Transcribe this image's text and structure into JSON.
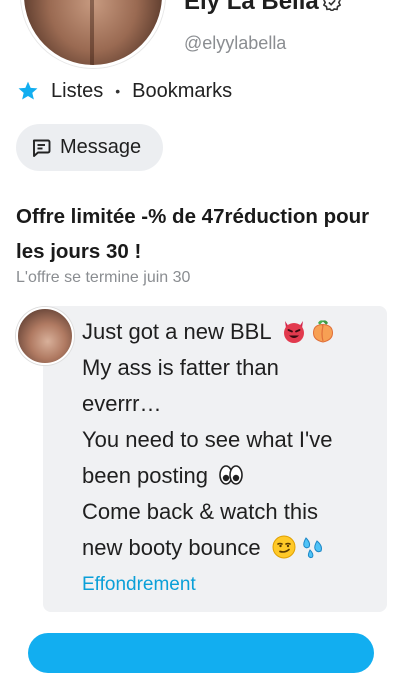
{
  "profile": {
    "name": "Ely La Bella",
    "handle": "@elyylabella"
  },
  "nav": {
    "lists_label": "Listes",
    "separator": "•",
    "bookmarks_label": "Bookmarks"
  },
  "actions": {
    "message_label": "Message"
  },
  "offer": {
    "title": "Offre limitée -% de 47réduction pour les jours 30 !",
    "subtitle": "L'offre se termine juin 30"
  },
  "post": {
    "lines": [
      "Just got a new BBL",
      "My ass is fatter than",
      "everrr…",
      "You need to see what I've",
      "been posting",
      "Come back & watch this",
      "new booty bounce"
    ],
    "collapse_label": "Effondrement"
  },
  "colors": {
    "accent": "#0a9fd8",
    "button_bg": "#eceef1",
    "card_bg": "#f0f1f3",
    "muted_text": "#8a8d91",
    "primary_button": "#12aef0"
  },
  "icons": {
    "star": "star-icon",
    "message": "message-icon",
    "verified": "verified-icon"
  }
}
